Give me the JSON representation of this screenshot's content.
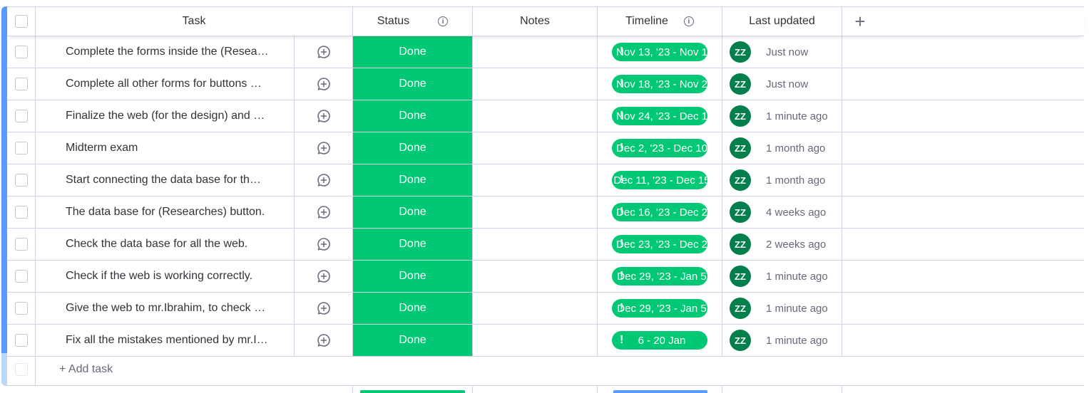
{
  "header": {
    "task": "Task",
    "status": "Status",
    "notes": "Notes",
    "timeline": "Timeline",
    "last_updated": "Last updated"
  },
  "icons": {
    "info": "info-icon",
    "add_column": "plus-icon",
    "conversation": "add-update-icon",
    "alert": "exclamation-icon"
  },
  "colors": {
    "done": "#00c875",
    "group": "#579bfc",
    "avatar": "#037f4c"
  },
  "rows": [
    {
      "task": "Complete the forms inside the (Resea…",
      "status": "Done",
      "timeline": "Nov 13, '23 - Nov 1",
      "avatar": "ZZ",
      "updated": "Just now"
    },
    {
      "task": "Complete all other forms for buttons …",
      "status": "Done",
      "timeline": "Nov 18, '23 - Nov 2",
      "avatar": "ZZ",
      "updated": "Just now"
    },
    {
      "task": "Finalize the web (for the design) and …",
      "status": "Done",
      "timeline": "Nov 24, '23 - Dec 1",
      "avatar": "ZZ",
      "updated": "1 minute ago"
    },
    {
      "task": "Midterm exam",
      "status": "Done",
      "timeline": "Dec 2, '23 - Dec 10",
      "avatar": "ZZ",
      "updated": "1 month ago"
    },
    {
      "task": "Start connecting the data base for th…",
      "status": "Done",
      "timeline": "Dec 11, '23 - Dec 15",
      "avatar": "ZZ",
      "updated": "1 month ago"
    },
    {
      "task": "The data base for (Researches) button.",
      "status": "Done",
      "timeline": "Dec 16, '23 - Dec 2",
      "avatar": "ZZ",
      "updated": "4 weeks ago"
    },
    {
      "task": "Check the data base for all the web.",
      "status": "Done",
      "timeline": "Dec 23, '23 - Dec 2",
      "avatar": "ZZ",
      "updated": "2 weeks ago"
    },
    {
      "task": "Check if the web is working correctly.",
      "status": "Done",
      "timeline": "Dec 29, '23 - Jan 5",
      "avatar": "ZZ",
      "updated": "1 minute ago"
    },
    {
      "task": "Give the web to mr.Ibrahim, to check …",
      "status": "Done",
      "timeline": "Dec 29, '23 - Jan 5",
      "avatar": "ZZ",
      "updated": "1 minute ago"
    },
    {
      "task": "Fix all the mistakes mentioned by mr.I…",
      "status": "Done",
      "timeline": "6 - 20 Jan",
      "avatar": "ZZ",
      "updated": "1 minute ago"
    }
  ],
  "add_task_label": "+ Add task"
}
